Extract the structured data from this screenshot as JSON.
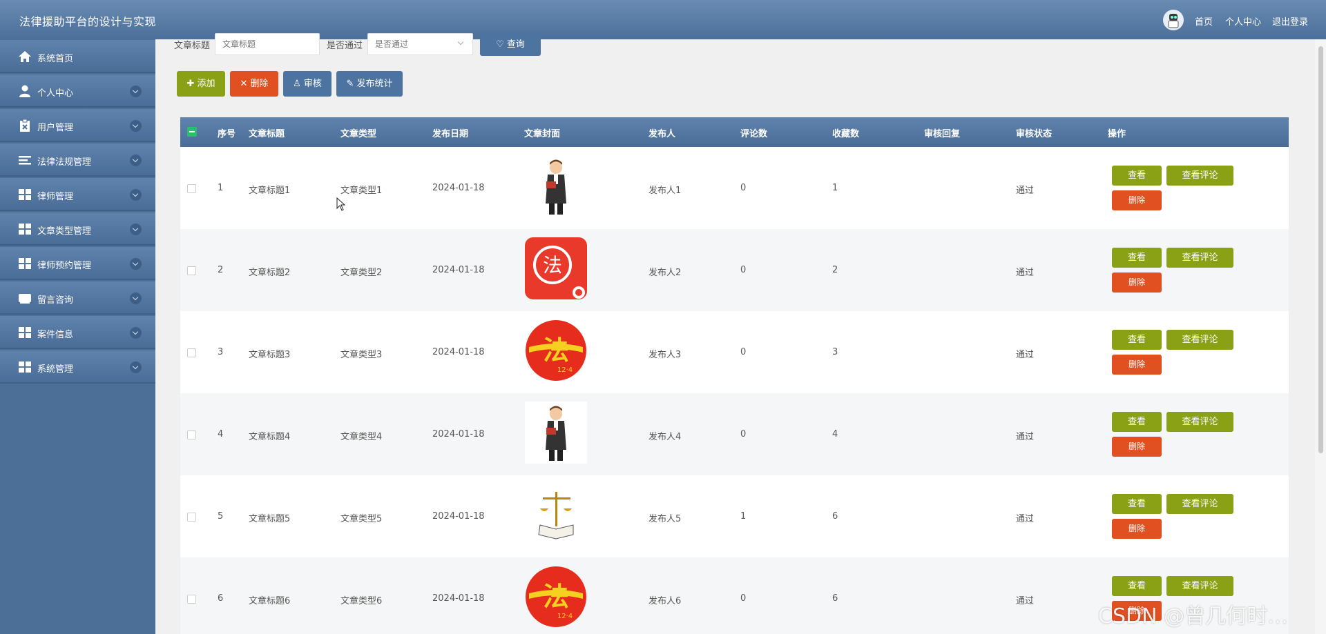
{
  "header": {
    "app_title": "法律援助平台的设计与实现",
    "nav": {
      "home": "首页",
      "profile": "个人中心",
      "logout": "退出登录"
    }
  },
  "sidebar": {
    "items": [
      {
        "label": "系统首页",
        "icon": "home-icon"
      },
      {
        "label": "个人中心",
        "icon": "user-icon"
      },
      {
        "label": "用户管理",
        "icon": "clipboard-icon"
      },
      {
        "label": "法律法规管理",
        "icon": "list-icon"
      },
      {
        "label": "律师管理",
        "icon": "grid-icon"
      },
      {
        "label": "文章类型管理",
        "icon": "grid-icon"
      },
      {
        "label": "律师预约管理",
        "icon": "grid-icon"
      },
      {
        "label": "留言咨询",
        "icon": "inbox-icon"
      },
      {
        "label": "案件信息",
        "icon": "grid-icon"
      },
      {
        "label": "系统管理",
        "icon": "grid-icon"
      }
    ]
  },
  "search": {
    "title_label": "文章标题",
    "title_placeholder": "文章标题",
    "pass_label": "是否通过",
    "pass_placeholder": "是否通过",
    "query_button": "查询"
  },
  "toolbar": {
    "add": "添加",
    "delete": "删除",
    "audit": "审核",
    "stats": "发布统计"
  },
  "table": {
    "columns": [
      "序号",
      "文章标题",
      "文章类型",
      "发布日期",
      "文章封面",
      "发布人",
      "评论数",
      "收藏数",
      "审核回复",
      "审核状态",
      "操作"
    ],
    "rows": [
      {
        "no": "1",
        "title": "文章标题1",
        "type": "文章类型1",
        "date": "2024-01-18",
        "cover": "lawyer",
        "publisher": "发布人1",
        "comments": "0",
        "favorites": "1",
        "reply": "",
        "status": "通过"
      },
      {
        "no": "2",
        "title": "文章标题2",
        "type": "文章类型2",
        "date": "2024-01-18",
        "cover": "fa-app",
        "publisher": "发布人2",
        "comments": "0",
        "favorites": "2",
        "reply": "",
        "status": "通过"
      },
      {
        "no": "3",
        "title": "文章标题3",
        "type": "文章类型3",
        "date": "2024-01-18",
        "cover": "fa-circle",
        "publisher": "发布人3",
        "comments": "0",
        "favorites": "3",
        "reply": "",
        "status": "通过"
      },
      {
        "no": "4",
        "title": "文章标题4",
        "type": "文章类型4",
        "date": "2024-01-18",
        "cover": "lawyer",
        "publisher": "发布人4",
        "comments": "0",
        "favorites": "4",
        "reply": "",
        "status": "通过"
      },
      {
        "no": "5",
        "title": "文章标题5",
        "type": "文章类型5",
        "date": "2024-01-18",
        "cover": "scales",
        "publisher": "发布人5",
        "comments": "1",
        "favorites": "6",
        "reply": "",
        "status": "通过"
      },
      {
        "no": "6",
        "title": "文章标题6",
        "type": "文章类型6",
        "date": "2024-01-18",
        "cover": "fa-circle",
        "publisher": "发布人6",
        "comments": "0",
        "favorites": "6",
        "reply": "",
        "status": "通过"
      }
    ],
    "actions": {
      "view": "查看",
      "view_comments": "查看评论",
      "delete": "删除"
    }
  },
  "cover_texts": {
    "fa": "法",
    "date_mark": "12·4"
  },
  "watermark": "CSDN @曾几何时…",
  "colors": {
    "primary": "#4d74a0",
    "success": "#8aa115",
    "danger": "#e05020"
  }
}
